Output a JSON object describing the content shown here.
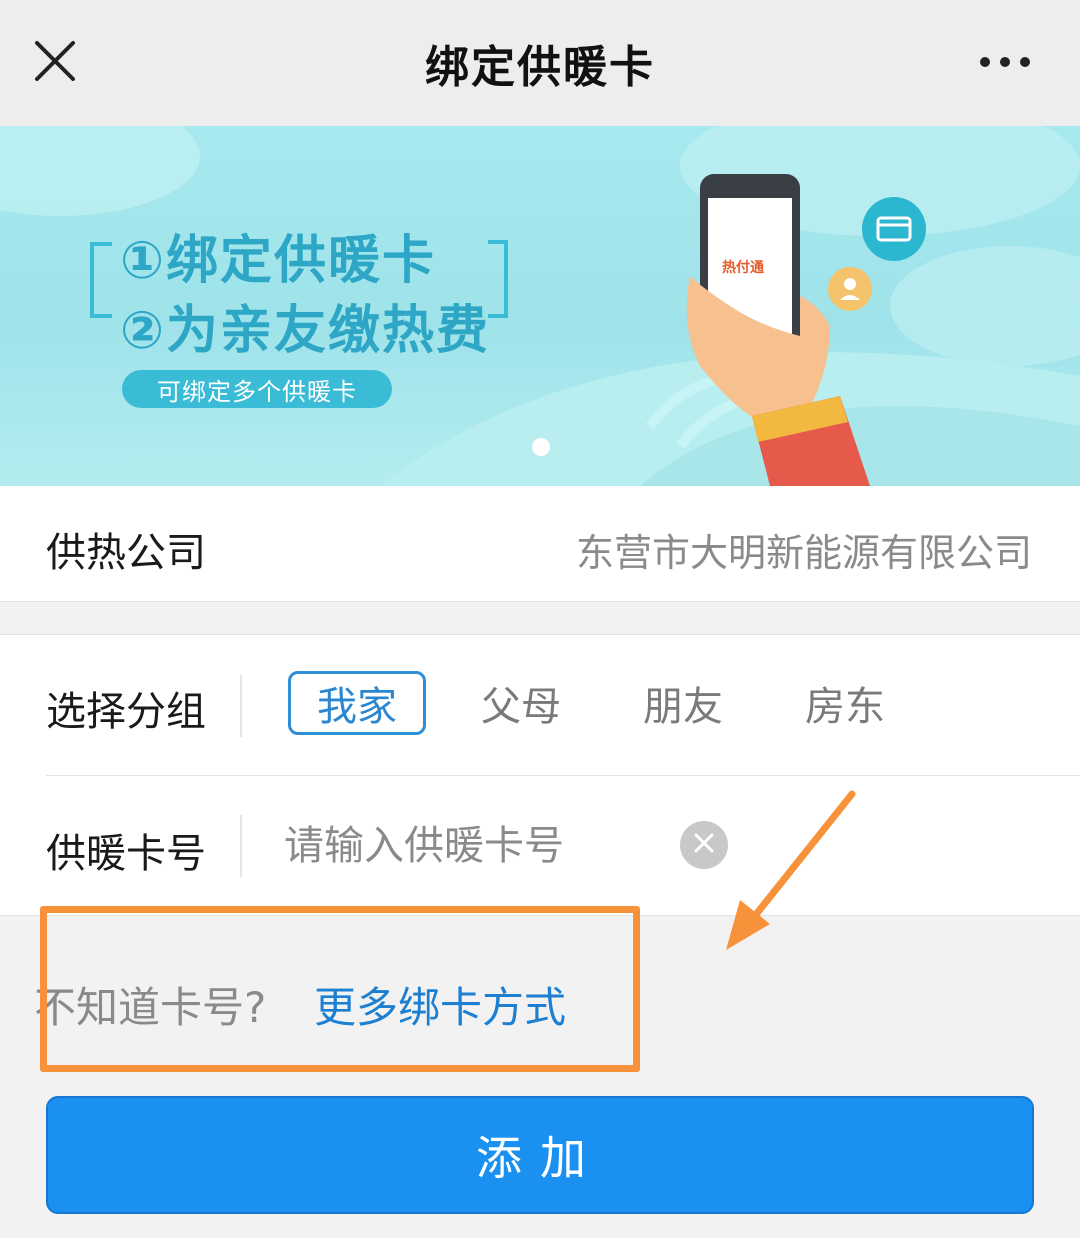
{
  "header": {
    "title": "绑定供暖卡",
    "close_icon": "close-icon",
    "more_icon": "more-dots-icon"
  },
  "banner": {
    "line1": "①绑定供暖卡",
    "line2": "②为亲友缴热费",
    "pill": "可绑定多个供暖卡",
    "phone_logo": "热付通",
    "carousel_pages": 1,
    "carousel_active": 1
  },
  "company": {
    "label": "供热公司",
    "value": "东营市大明新能源有限公司"
  },
  "group": {
    "label": "选择分组",
    "options": [
      "我家",
      "父母",
      "朋友",
      "房东"
    ],
    "selected": "我家"
  },
  "card": {
    "label": "供暖卡号",
    "placeholder": "请输入供暖卡号",
    "value": "",
    "clear_icon": "clear-icon"
  },
  "hint": {
    "question": "不知道卡号?",
    "link": "更多绑卡方式"
  },
  "annotation": {
    "color": "#f7923a"
  },
  "submit": {
    "label": "添加"
  },
  "colors": {
    "accent": "#1a90f0",
    "link": "#1c7fd1",
    "banner_bg": "#a6e9ee"
  }
}
